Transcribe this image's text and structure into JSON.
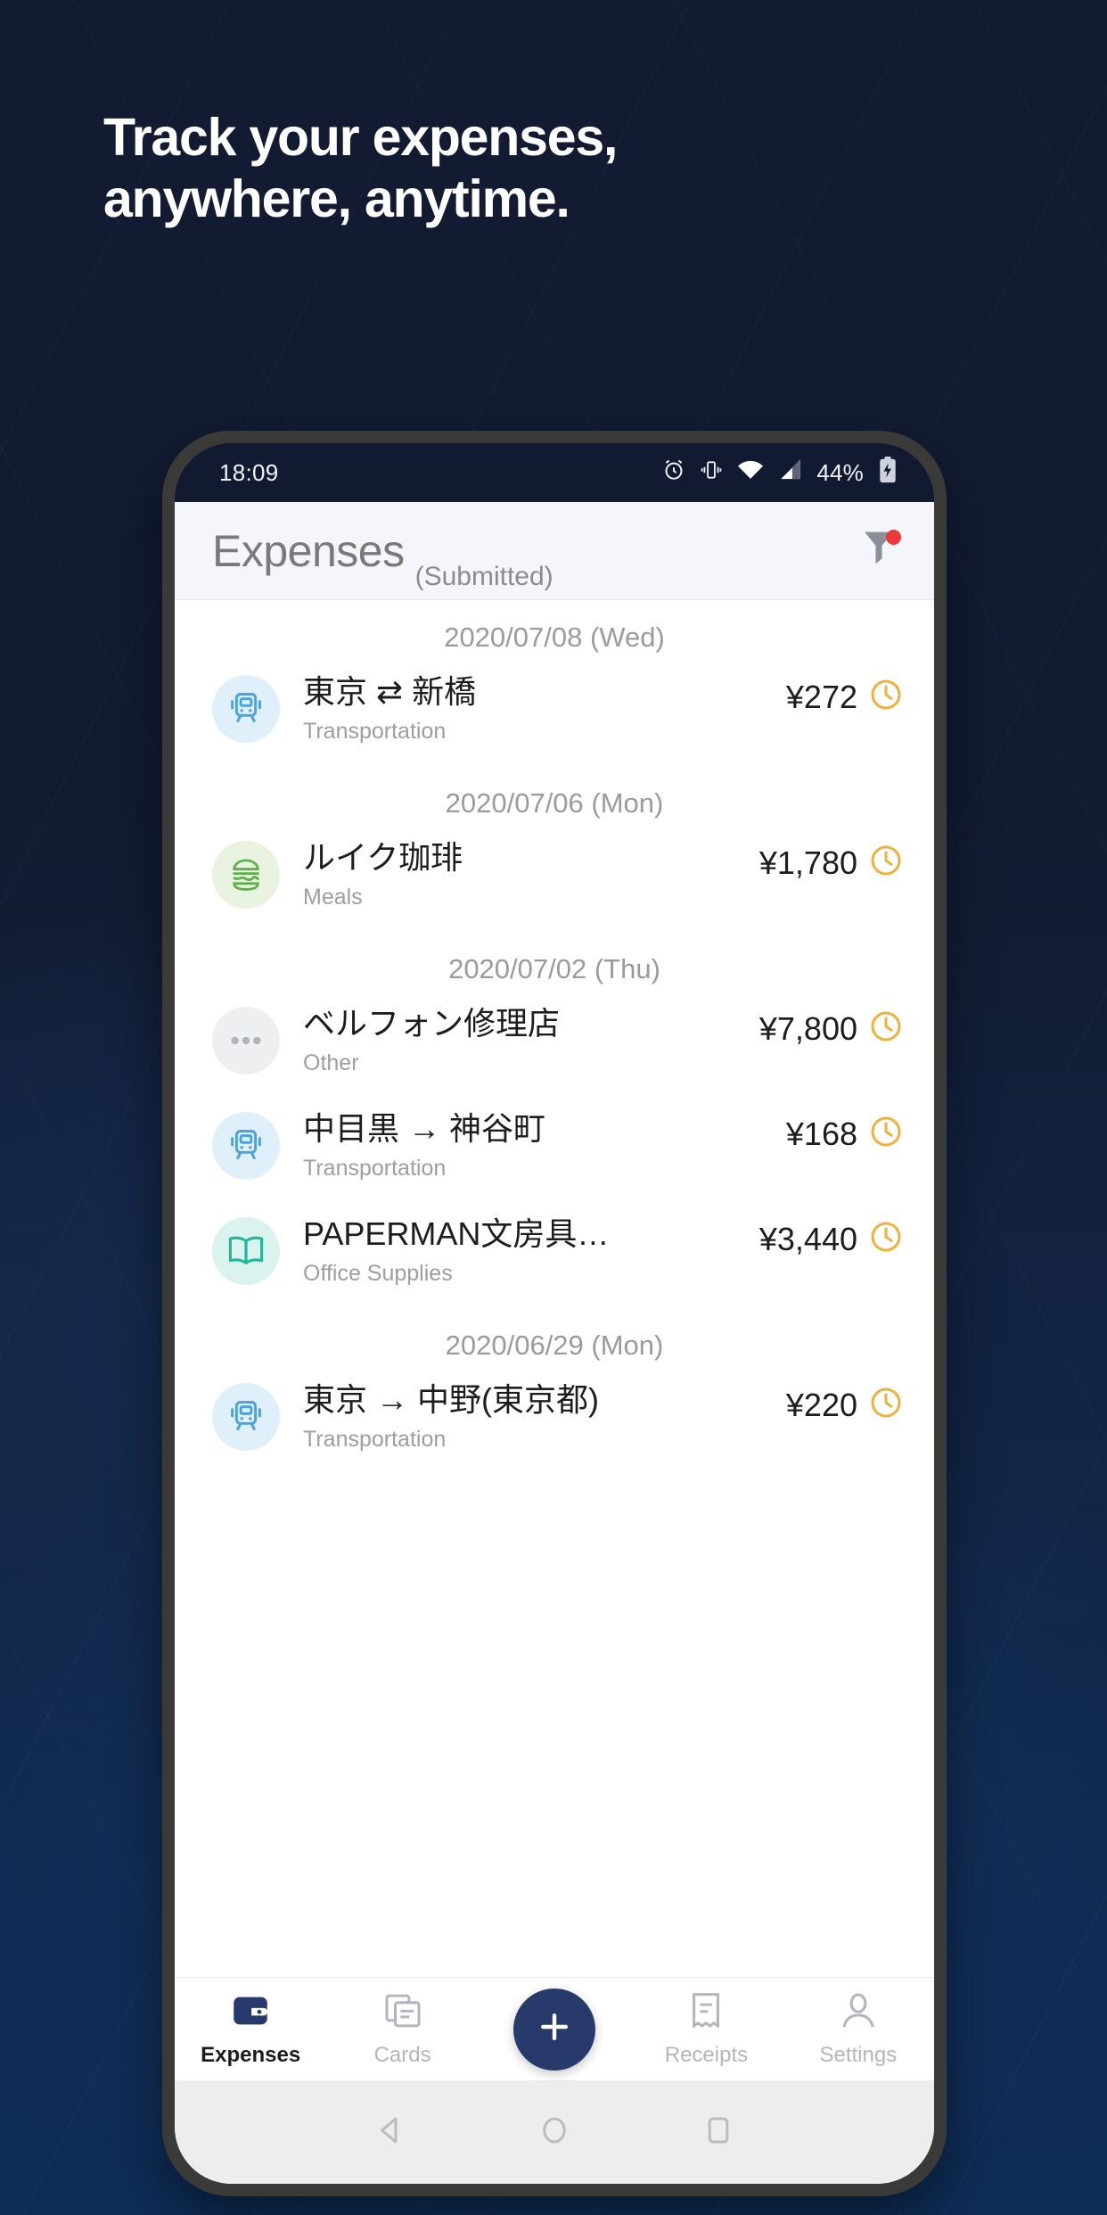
{
  "promo": {
    "headline_line1": "Track your expenses,",
    "headline_line2": "anywhere, anytime.",
    "bg_color": "#121b31",
    "accent_color": "#273a6b"
  },
  "statusbar": {
    "time": "18:09",
    "battery_percent": "44%",
    "icons": [
      "alarm-icon",
      "vibrate-icon",
      "wifi-icon",
      "cellular-signal-icon",
      "battery-charging-icon"
    ]
  },
  "app_header": {
    "title": "Expenses",
    "subtitle": "(Submitted)",
    "filter_icon": "filter-funnel-icon",
    "filter_badge_color": "#ec3a3a"
  },
  "list": [
    {
      "date": "2020/07/08 (Wed)",
      "rows": [
        {
          "title": "東京 ⇄ 新橋",
          "category": "Transportation",
          "amount": "¥272",
          "icon": "train-icon",
          "icon_color": "#4aa3e0",
          "icon_bg": "#dff0fb",
          "status_icon": "clock-pending-icon",
          "status_color": "#efb13a"
        }
      ]
    },
    {
      "date": "2020/07/06 (Mon)",
      "rows": [
        {
          "title": "ルイク珈琲",
          "category": "Meals",
          "amount": "¥1,780",
          "icon": "burger-icon",
          "icon_color": "#5fb04a",
          "icon_bg": "#e8f4e0",
          "status_icon": "clock-pending-icon",
          "status_color": "#efb13a"
        }
      ]
    },
    {
      "date": "2020/07/02 (Thu)",
      "rows": [
        {
          "title": "ベルフォン修理店",
          "category": "Other",
          "amount": "¥7,800",
          "icon": "ellipsis-icon",
          "icon_color": "#b0b3b8",
          "icon_bg": "#eeeff1",
          "status_icon": "clock-pending-icon",
          "status_color": "#efb13a"
        },
        {
          "title": "中目黒 → 神谷町",
          "category": "Transportation",
          "amount": "¥168",
          "icon": "train-icon",
          "icon_color": "#4aa3e0",
          "icon_bg": "#dff0fb",
          "status_icon": "clock-pending-icon",
          "status_color": "#efb13a"
        },
        {
          "title": "PAPERMAN文房具…",
          "category": "Office Supplies",
          "amount": "¥3,440",
          "icon": "book-icon",
          "icon_color": "#21b89a",
          "icon_bg": "#daf3ee",
          "status_icon": "clock-pending-icon",
          "status_color": "#efb13a"
        }
      ]
    },
    {
      "date": "2020/06/29 (Mon)",
      "rows": [
        {
          "title": "東京 → 中野(東京都)",
          "category": "Transportation",
          "amount": "¥220",
          "icon": "train-icon",
          "icon_color": "#4aa3e0",
          "icon_bg": "#dff0fb",
          "status_icon": "clock-pending-icon",
          "status_color": "#efb13a"
        }
      ]
    }
  ],
  "bottom_nav": {
    "items": [
      {
        "label": "Expenses",
        "icon": "wallet-icon",
        "active": true
      },
      {
        "label": "Cards",
        "icon": "cards-icon",
        "active": false
      },
      {
        "label": "Receipts",
        "icon": "receipt-icon",
        "active": false
      },
      {
        "label": "Settings",
        "icon": "person-icon",
        "active": false
      }
    ],
    "fab_icon": "plus-icon"
  },
  "android_nav": {
    "back": "back-triangle-icon",
    "home": "home-circle-icon",
    "recents": "recents-square-icon"
  }
}
